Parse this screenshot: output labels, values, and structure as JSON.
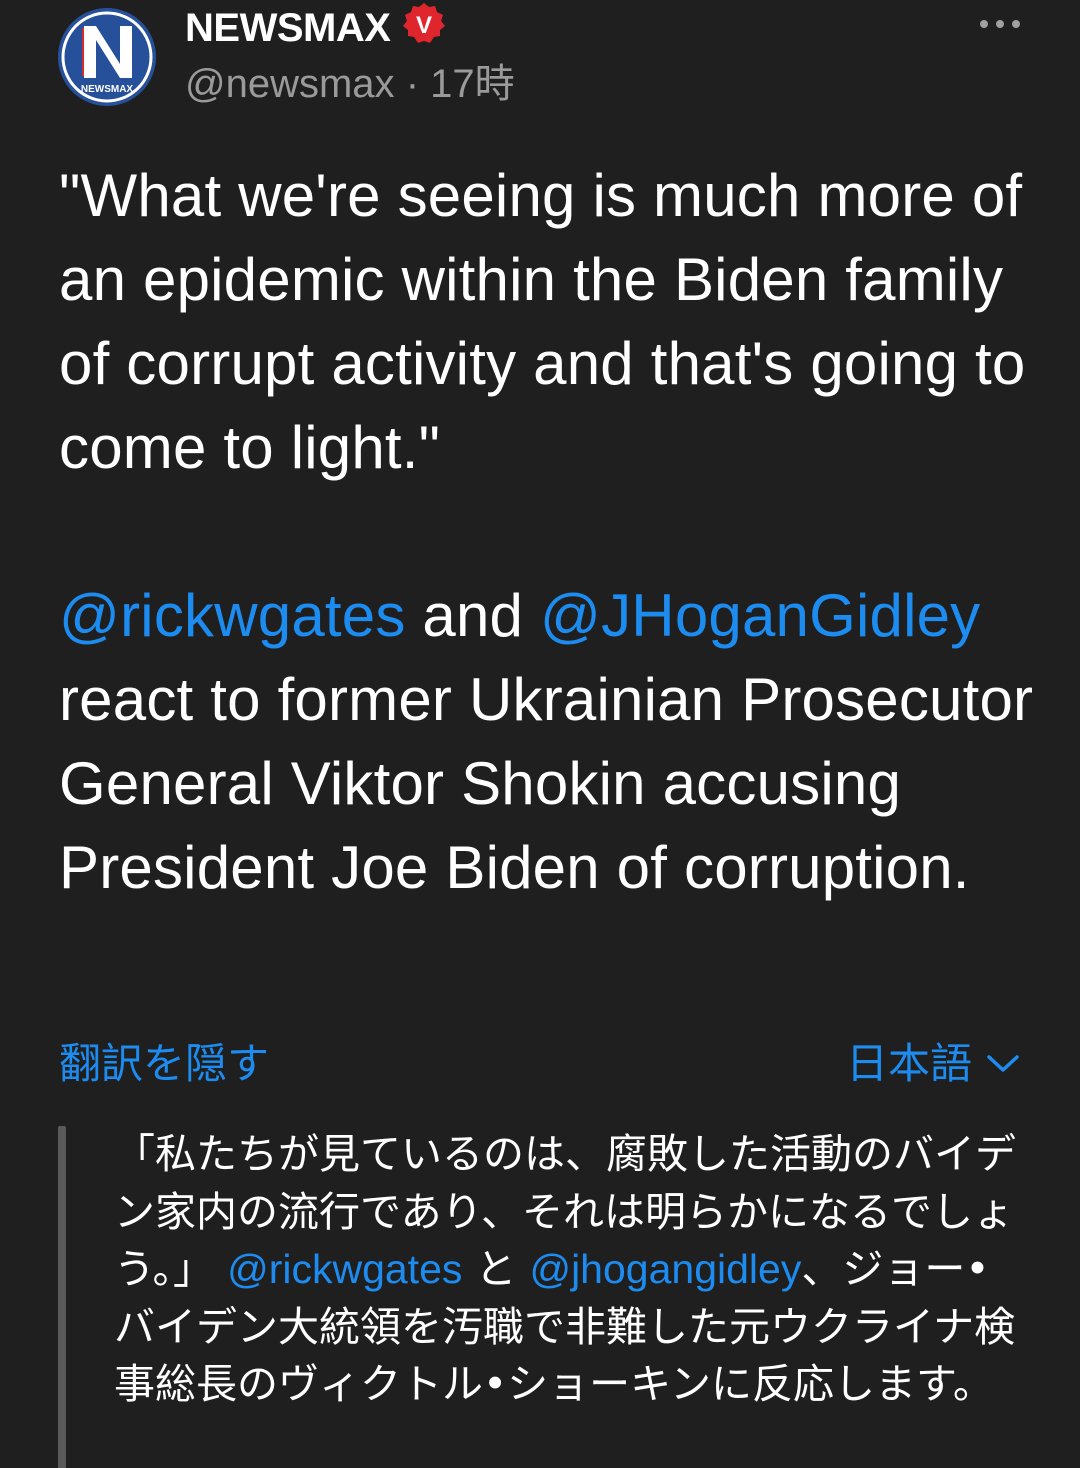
{
  "header": {
    "display_name": "NEWSMAX",
    "handle": "@newsmax",
    "separator": "·",
    "timestamp": "17時",
    "avatar_text": "NEWSMAX",
    "avatar_letter": "N",
    "verified_letter": "V"
  },
  "tweet": {
    "quote": "\"What we're seeing is much more of an epidemic within the Biden family of corrupt activity and that's going to come to light.\"",
    "mention1": "@rickwgates",
    "conj": " and ",
    "mention2": "@JHoganGidley",
    "rest": " react to former Ukrainian Prosecutor General Viktor Shokin accusing President Joe Biden of corruption."
  },
  "translation": {
    "hide_label": "翻訳を隠す",
    "language_label": "日本語",
    "part1": "「私たちが見ているのは、腐敗した活動のバイデン家内の流行であり、それは明らかになるでしょう。」 ",
    "mention1": "@rickwgates",
    "conj": " と ",
    "mention2": "@jhogangidley",
    "part2": "、ジョー•バイデン大統領を汚職で非難した元ウクライナ検事総長のヴィクトル•ショーキンに反応します。"
  },
  "colors": {
    "background": "#1f1f1f",
    "link": "#1d8cf0",
    "secondary_text": "#9a9a9a",
    "verified_badge": "#e0262d",
    "brand_blue": "#26509a"
  },
  "icons": {
    "more": "more-horizontal-icon",
    "verified": "verified-badge-icon",
    "chevron": "chevron-down-icon"
  }
}
